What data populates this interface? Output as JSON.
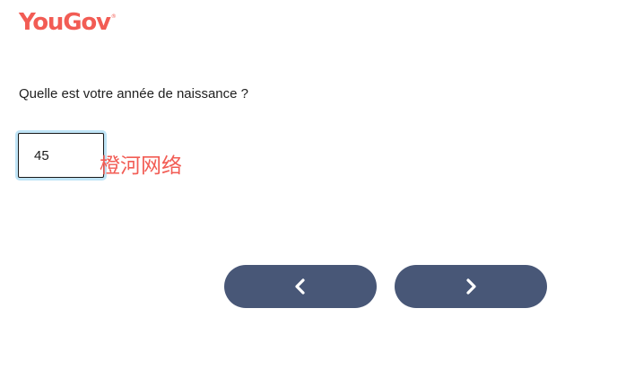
{
  "brand": {
    "logo_text": "YouGov",
    "logo_mark": "®",
    "color": "#f25c54"
  },
  "question": {
    "text": "Quelle est votre année de naissance ?"
  },
  "answer_input": {
    "value": "45",
    "focus_ring_color": "#bfe4f6"
  },
  "watermark": {
    "text": "橙河网络",
    "color": "#f25c54"
  },
  "navigation": {
    "button_color": "#485777",
    "prev_icon": "chevron-left-icon",
    "next_icon": "chevron-right-icon"
  }
}
